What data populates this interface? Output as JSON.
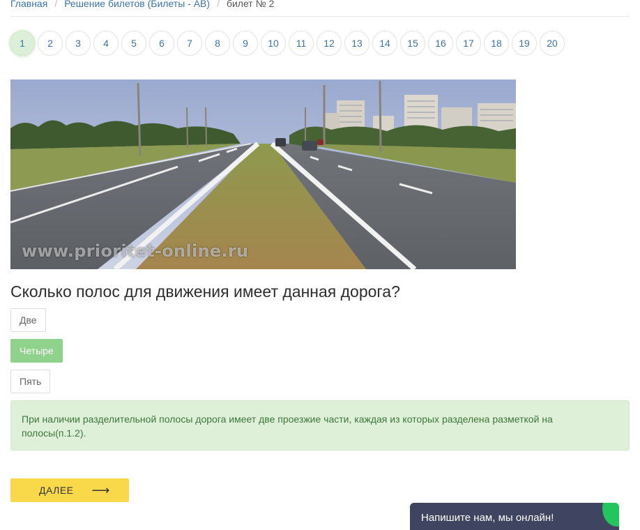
{
  "breadcrumb": {
    "home": "Главная",
    "section": "Решение билетов (Билеты - АВ)",
    "current": "билет № 2"
  },
  "pagination": {
    "active": "1",
    "pages": [
      "1",
      "2",
      "3",
      "4",
      "5",
      "6",
      "7",
      "8",
      "9",
      "10",
      "11",
      "12",
      "13",
      "14",
      "15",
      "16",
      "17",
      "18",
      "19",
      "20"
    ]
  },
  "image": {
    "watermark": "www.prioritet-online.ru"
  },
  "question": {
    "text": "Сколько полос для движения имеет данная дорога?"
  },
  "answers": [
    {
      "label": "Две",
      "state": "default"
    },
    {
      "label": "Четыре",
      "state": "correct"
    },
    {
      "label": "Пять",
      "state": "default"
    }
  ],
  "explanation": "При наличии разделительной полосы дорога имеет две проезжие части, каждая из которых разделена разметкой на полосы(п.1.2).",
  "next_button": {
    "label": "ДАЛЕЕ",
    "icon": "arrow-right-icon"
  },
  "chat": {
    "label": "Напишите нам, мы онлайн!"
  },
  "colors": {
    "link": "#3b74a8",
    "correct_answer": "#8fd28c",
    "explanation_bg": "#dff0d8",
    "explanation_text": "#3c763d",
    "next_button": "#f9d849",
    "chat_bg": "#3f4460",
    "chat_accent": "#22c55e"
  }
}
